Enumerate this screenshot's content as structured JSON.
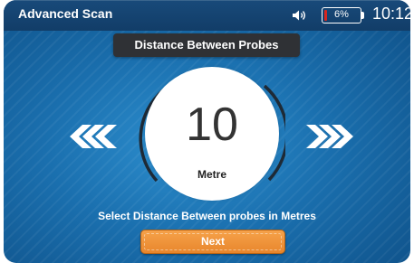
{
  "app": {
    "title": "Advanced Scan",
    "battery_percent": "6%",
    "battery_level": 0.06,
    "clock": "10:12"
  },
  "dialog": {
    "header": "Distance Between Probes",
    "value": "10",
    "unit": "Metre",
    "instruction": "Select Distance Between probes in Metres",
    "next_label": "Next"
  },
  "icons": {
    "speaker": "speaker-icon",
    "decrease": "double-chevron-left-icon",
    "increase": "double-chevron-right-icon"
  },
  "colors": {
    "accent": "#e8862c",
    "battery_low": "#d8261f",
    "background": "#1a6fae"
  }
}
